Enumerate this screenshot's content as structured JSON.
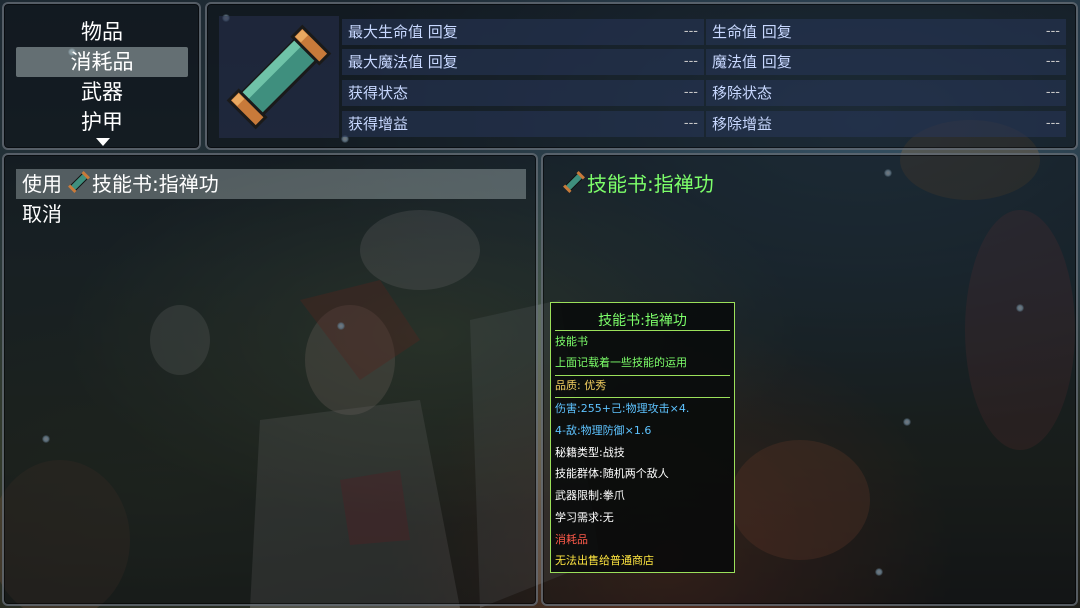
{
  "categories": {
    "items": [
      {
        "label": "物品"
      },
      {
        "label": "消耗品"
      },
      {
        "label": "武器"
      },
      {
        "label": "护甲"
      }
    ],
    "selected_index": 1
  },
  "stats": {
    "left": [
      {
        "label": "最大生命值 回复",
        "value": "---"
      },
      {
        "label": "最大魔法值 回复",
        "value": "---"
      },
      {
        "label": "获得状态",
        "value": "---"
      },
      {
        "label": "获得增益",
        "value": "---"
      }
    ],
    "right": [
      {
        "label": "生命值 回复",
        "value": "---"
      },
      {
        "label": "魔法值 回复",
        "value": "---"
      },
      {
        "label": "移除状态",
        "value": "---"
      },
      {
        "label": "移除增益",
        "value": "---"
      }
    ]
  },
  "commands": {
    "use_label": "使用",
    "item_name": "技能书:指禅功",
    "cancel_label": "取消"
  },
  "detail": {
    "title": "技能书:指禅功"
  },
  "tooltip": {
    "title": "技能书:指禅功",
    "type": "技能书",
    "description": "上面记载着一些技能的运用",
    "quality": "品质: 优秀",
    "damage_line1": "伤害:255+己:物理攻击×4.",
    "damage_line2": "4-敌:物理防御×1.6",
    "secret_type": "秘籍类型:战技",
    "target_group": "技能群体:随机两个敌人",
    "weapon_limit": "武器限制:拳爪",
    "learn_req": "学习需求:无",
    "consumable": "消耗品",
    "sell_note": "无法出售给普通商店"
  },
  "colors": {
    "highlight_green": "#7dff6a",
    "tooltip_border": "#9be05a",
    "stat_label": "#c8d8ff"
  },
  "icons": {
    "item": "scroll-icon",
    "more": "arrow-down-icon"
  }
}
